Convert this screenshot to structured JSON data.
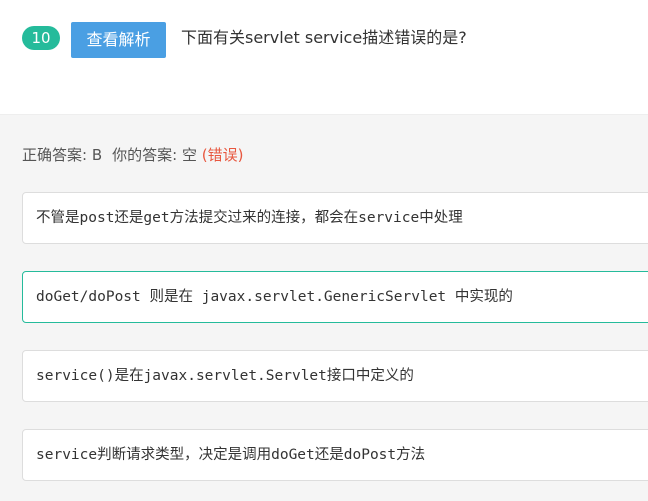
{
  "question": {
    "number": "10",
    "analysis_button": "查看解析",
    "title": "下面有关servlet service描述错误的是?"
  },
  "result": {
    "correct_label": "正确答案: B",
    "your_label": "你的答案: 空",
    "status": "(错误)"
  },
  "options": [
    {
      "text": "不管是post还是get方法提交过来的连接，都会在service中处理"
    },
    {
      "text": "doGet/doPost 则是在 javax.servlet.GenericServlet 中实现的"
    },
    {
      "text": "service()是在javax.servlet.Servlet接口中定义的"
    },
    {
      "text": "service判断请求类型，决定是调用doGet还是doPost方法"
    }
  ],
  "colors": {
    "badge": "#25bb9b",
    "button": "#4a9fe3",
    "wrong": "#e8573f",
    "selected_border": "#25bb9b"
  }
}
